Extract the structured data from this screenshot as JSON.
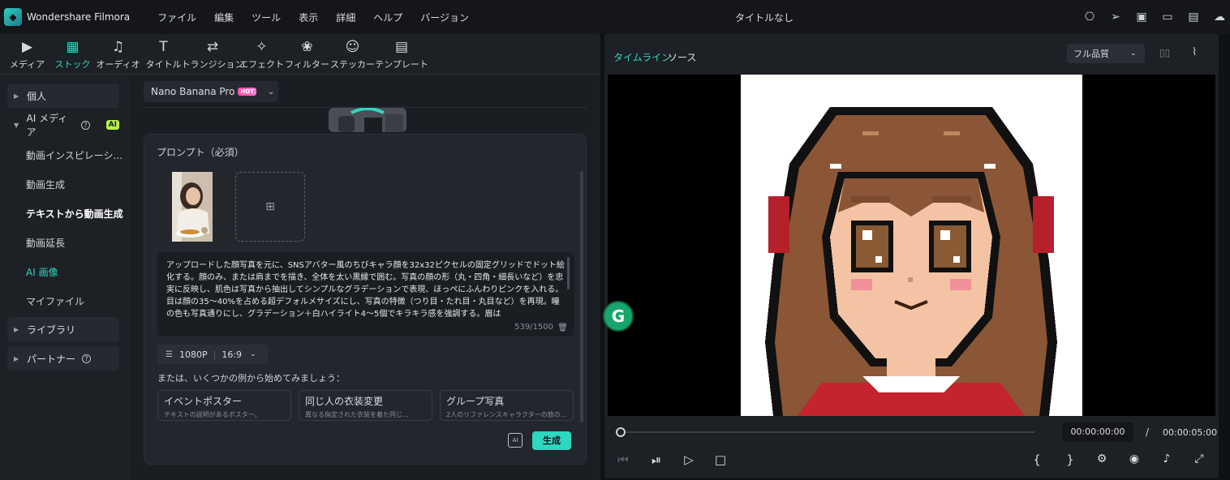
{
  "app": {
    "name": "Wondershare Filmora",
    "doc_title": "タイトルなし",
    "menu": [
      "ファイル",
      "編集",
      "ツール",
      "表示",
      "詳細",
      "ヘルプ",
      "バージョン"
    ]
  },
  "tabs": [
    {
      "label": "メディア",
      "icon": "media-icon",
      "glyph": "▶"
    },
    {
      "label": "ストック",
      "icon": "stock-icon",
      "glyph": "▦"
    },
    {
      "label": "オーディオ",
      "icon": "audio-icon",
      "glyph": "♫"
    },
    {
      "label": "タイトル",
      "icon": "title-icon",
      "glyph": "T"
    },
    {
      "label": "トランジション",
      "icon": "transition-icon",
      "glyph": "⇄"
    },
    {
      "label": "エフェクト",
      "icon": "effect-icon",
      "glyph": "✧"
    },
    {
      "label": "フィルター",
      "icon": "filter-icon",
      "glyph": "❀"
    },
    {
      "label": "ステッカー",
      "icon": "sticker-icon",
      "glyph": "☺"
    },
    {
      "label": "テンプレート",
      "icon": "template-icon",
      "glyph": "▤"
    }
  ],
  "sidebar": {
    "personal": "個人",
    "ai_media": "AI メディア",
    "ai_badge": "AI",
    "items": [
      "動画インスピレーシ...",
      "動画生成",
      "テキストから動画生成",
      "動画延長",
      "AI 画像",
      "マイファイル"
    ],
    "library": "ライブラリ",
    "partner": "パートナー"
  },
  "model": {
    "name": "Nano Banana Pro",
    "badge": "HOT"
  },
  "prompt": {
    "title": "プロンプト（必須）",
    "text": "アップロードした顔写真を元に、SNSアバター風のちびキャラ顔を32x32ピクセルの固定グリッドでドット絵化する。顔のみ、または肩までを描き、全体を太い黒縁で囲む。写真の顔の形（丸・四角・細長いなど）を忠実に反映し、肌色は写真から抽出してシンプルなグラデーションで表現、ほっぺにふんわりピンクを入れる。目は顔の35〜40%を占める超デフォルメサイズにし、写真の特徴（つり目・たれ目・丸目など）を再現。瞳の色も写真通りにし、グラデーション＋白ハイライト4〜5個でキラキラ感を強調する。眉は",
    "char_count": "539/1500",
    "resolution": "1080P",
    "aspect": "16:9",
    "examples_title": "または、いくつかの例から始めてみましょう：",
    "examples": [
      {
        "title": "イベントポスター",
        "desc": "テキストの説明があるポスター。"
      },
      {
        "title": "同じ人の衣装変更",
        "desc": "異なる指定された衣装を着た同じ..."
      },
      {
        "title": "グループ写真",
        "desc": "2人のリファレンスキャラクターの旅の..."
      }
    ],
    "generate": "生成"
  },
  "player": {
    "tab_timeline": "タイムライン",
    "tab_source": "ソース",
    "quality": "フル品質",
    "time_current": "00:00:00:00",
    "time_sep": "/",
    "time_total": "00:00:05:00",
    "progress": 0.0
  },
  "colors": {
    "accent": "#2fd6c0",
    "ai_badge": "#b7f24a",
    "hot_badge": "#ff4fa8"
  }
}
